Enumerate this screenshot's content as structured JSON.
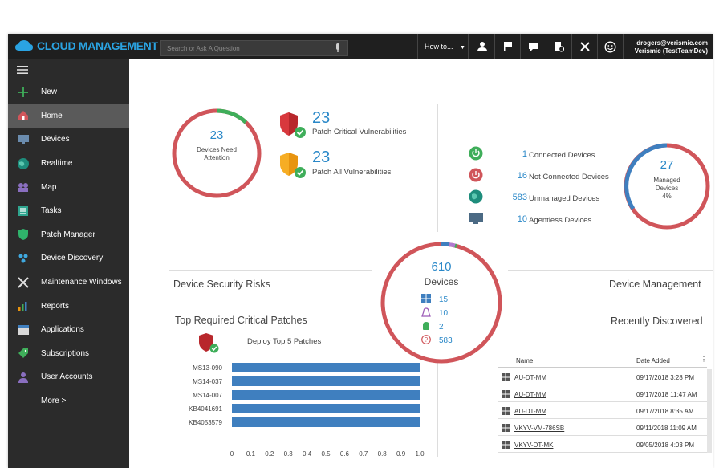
{
  "app": {
    "brand": "CLOUD MANAGEMENT SUITE",
    "search_placeholder": "Search or Ask A Question",
    "howto_label": "How to...",
    "user_email": "drogers@verismic.com",
    "user_org": "Verismic (TestTeamDev)"
  },
  "sidebar": {
    "items": [
      {
        "label": "New",
        "icon": "plus-icon"
      },
      {
        "label": "Home",
        "icon": "home-icon"
      },
      {
        "label": "Devices",
        "icon": "monitor-icon"
      },
      {
        "label": "Realtime",
        "icon": "globe-icon"
      },
      {
        "label": "Map",
        "icon": "map-icon"
      },
      {
        "label": "Tasks",
        "icon": "tasks-icon"
      },
      {
        "label": "Patch Manager",
        "icon": "shield-icon"
      },
      {
        "label": "Device Discovery",
        "icon": "discovery-icon"
      },
      {
        "label": "Maintenance Windows",
        "icon": "tools-icon"
      },
      {
        "label": "Reports",
        "icon": "reports-icon"
      },
      {
        "label": "Applications",
        "icon": "applications-icon"
      },
      {
        "label": "Subscriptions",
        "icon": "tag-icon"
      },
      {
        "label": "User Accounts",
        "icon": "user-icon"
      },
      {
        "label": "More >",
        "icon": ""
      }
    ],
    "active": "Home"
  },
  "security": {
    "needs_attention_count": "23",
    "needs_attention_label": "Devices Need Attention",
    "needs_attention_fraction_green": 0.12,
    "critical_count": "23",
    "critical_label": "Patch Critical Vulnerabilities",
    "all_count": "23",
    "all_label": "Patch All Vulnerabilities",
    "section_title": "Device Security Risks"
  },
  "management": {
    "connected_count": "1",
    "connected_label": "Connected Devices",
    "not_connected_count": "16",
    "not_connected_label": "Not Connected Devices",
    "unmanaged_count": "583",
    "unmanaged_label": "Unmanaged Devices",
    "agentless_count": "10",
    "agentless_label": "Agentless Devices",
    "managed_count": "27",
    "managed_label_1": "Managed",
    "managed_label_2": "Devices",
    "managed_pct": "4%",
    "section_title": "Device Management"
  },
  "devices": {
    "total": "610",
    "label": "Devices",
    "windows": "15",
    "linux": "10",
    "android": "2",
    "unknown": "583"
  },
  "patches": {
    "title": "Top Required Critical Patches",
    "deploy_label": "Deploy Top 5 Patches"
  },
  "chart_data": {
    "type": "bar",
    "orientation": "horizontal",
    "categories": [
      "MS13-090",
      "MS14-037",
      "MS14-007",
      "KB4041691",
      "KB4053579"
    ],
    "values": [
      1.0,
      1.0,
      1.0,
      1.0,
      1.0
    ],
    "xlim": [
      0,
      1.0
    ],
    "xticks": [
      "0",
      "0.1",
      "0.2",
      "0.3",
      "0.4",
      "0.5",
      "0.6",
      "0.7",
      "0.8",
      "0.9",
      "1.0"
    ],
    "bar_color": "#3f7fbf"
  },
  "recent": {
    "title": "Recently Discovered",
    "col_name": "Name",
    "col_date": "Date Added",
    "rows": [
      {
        "name": "AU-DT-MM",
        "date": "09/17/2018 3:28 PM"
      },
      {
        "name": "AU-DT-MM",
        "date": "09/17/2018 11:47 AM"
      },
      {
        "name": "AU-DT-MM",
        "date": "09/17/2018 8:35 AM"
      },
      {
        "name": "VKYV-VM-786SB",
        "date": "09/11/2018 11:09 AM"
      },
      {
        "name": "VKYV-DT-MK",
        "date": "09/05/2018 4:03 PM"
      }
    ]
  },
  "colors": {
    "accent": "#2a88c8",
    "danger": "#d0555a",
    "ok": "#3fae5a",
    "sidebar": "#2b2b2b",
    "topbar": "#1f1f1f"
  }
}
